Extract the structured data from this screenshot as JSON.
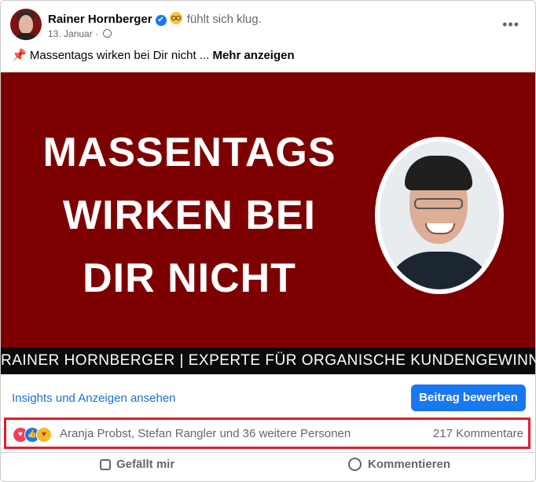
{
  "post": {
    "author": "Rainer Hornberger",
    "verified_icon": "✔",
    "feeling": "fühlt sich klug.",
    "date": "13. Januar",
    "date_separator": "·",
    "more_menu": "•••",
    "text_pin": "📌",
    "text": "Massentags wirken bei Dir nicht ...",
    "more_link": "Mehr anzeigen"
  },
  "banner": {
    "headline_line1": "MASSENTAGS",
    "headline_line2": "WIRKEN BEI",
    "headline_line3": "DIR NICHT",
    "strip_text": "RAINER HORNBERGER | EXPERTE FÜR ORGANISCHE KUNDENGEWINNUNG",
    "background_color": "#7d0000"
  },
  "promo": {
    "insights_link": "Insights und Anzeigen ansehen",
    "promote_button": "Beitrag bewerben"
  },
  "reactions": {
    "names": "Aranja Probst, Stefan Rangler und 36 weitere Personen",
    "comments": "217 Kommentare",
    "icons": [
      "love",
      "like",
      "care"
    ]
  },
  "actions": {
    "like": "Gefällt mir",
    "comment": "Kommentieren"
  },
  "colors": {
    "accent": "#1877f2",
    "highlight_border": "#e11d2b",
    "muted_text": "#65676b"
  }
}
